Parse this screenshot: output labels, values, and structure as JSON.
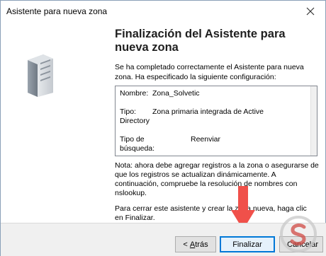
{
  "window": {
    "title": "Asistente para nueva zona"
  },
  "wizard": {
    "heading": "Finalización del Asistente para nueva zona",
    "intro": "Se ha completado correctamente el Asistente para nueva zona. Ha especificado la siguiente configuración:",
    "summary": {
      "name_label": "Nombre:",
      "name_value": "Zona_Solvetic",
      "type_label": "Tipo:",
      "type_value_line1": "Zona primaria integrada de Active",
      "type_value_line2": "Directory",
      "lookup_label": "Tipo de búsqueda:",
      "lookup_value": "Reenviar"
    },
    "note": "Nota: ahora debe agregar registros a la zona o asegurarse de que los registros se actualizan dinámicamente. A continuación, compruebe la resolución de nombres con nslookup.",
    "closing": "Para cerrar este asistente y crear la zona nueva, haga clic en Finalizar."
  },
  "buttons": {
    "back_prefix": "< ",
    "back_mnemonic": "A",
    "back_rest": "trás",
    "finish": "Finalizar",
    "cancel": "Cancelar"
  },
  "icons": {
    "close": "close-icon",
    "server": "server-icon",
    "annotation_arrow": "down-arrow-icon",
    "watermark": "solvetic-logo-icon"
  },
  "colors": {
    "accent": "#0078d7",
    "arrow": "#f0504a",
    "footer_bg": "#f0f0f0"
  }
}
